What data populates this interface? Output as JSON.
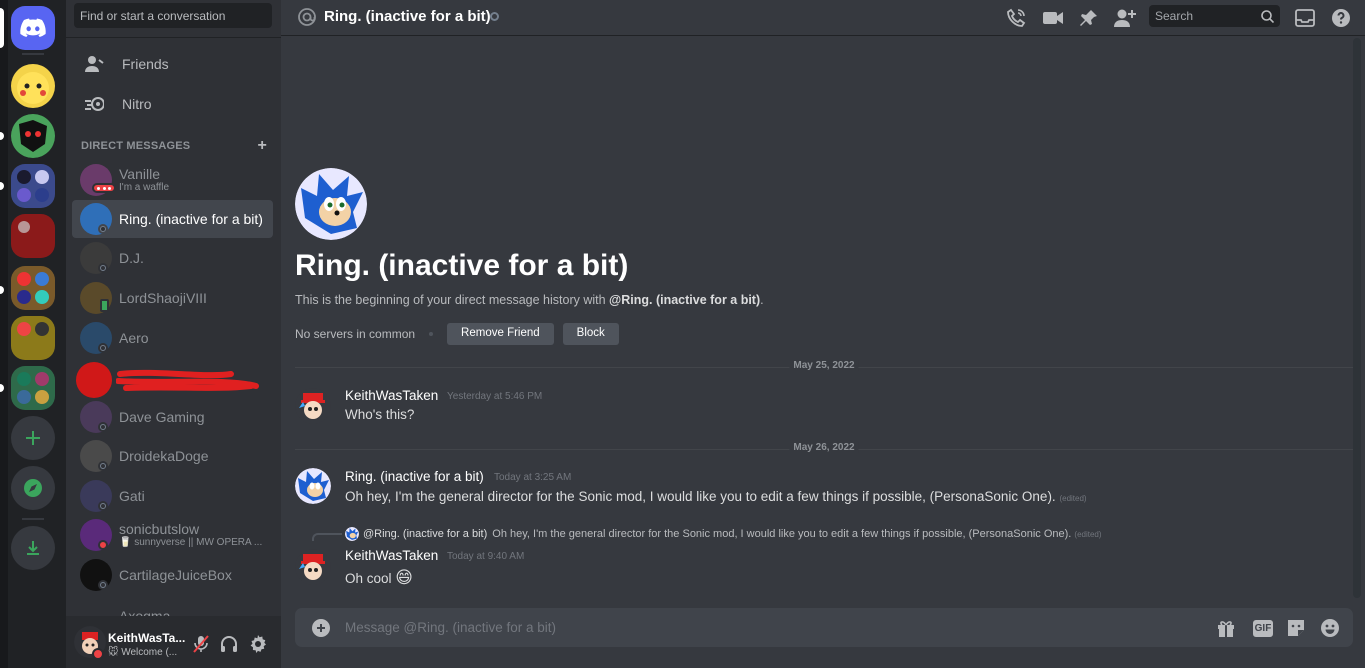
{
  "colors": {
    "blurple": "#5865f2",
    "bg": "#36393f",
    "sidebar": "#2f3136",
    "rail": "#202225",
    "offline": "#747f8d",
    "dnd": "#ed4245",
    "online": "#3ba55d",
    "redacted": "#e02020"
  },
  "rail": {
    "home_icon": "discord-logo-icon",
    "servers": [
      "server-1",
      "server-2",
      "server-3",
      "server-4",
      "server-5",
      "server-6",
      "server-7"
    ],
    "add_icon": "plus-icon",
    "explore_icon": "compass-icon",
    "download_icon": "download-icon"
  },
  "sidebar": {
    "search_placeholder": "Find or start a conversation",
    "nav": [
      {
        "label": "Friends",
        "icon": "friends-icon"
      },
      {
        "label": "Nitro",
        "icon": "nitro-icon"
      }
    ],
    "dm_header": "DIRECT MESSAGES",
    "dms": [
      {
        "name": "Vanille",
        "sub": "I'm a waffle",
        "status": "dnd"
      },
      {
        "name": "Ring. (inactive for a bit)",
        "status": "offline",
        "active": true
      },
      {
        "name": "D.J.",
        "status": "offline"
      },
      {
        "name": "LordShaojiVIII",
        "status": "mobile"
      },
      {
        "name": "Aero",
        "status": "offline"
      },
      {
        "name": "",
        "status": "redacted"
      },
      {
        "name": "Dave Gaming",
        "status": "offline"
      },
      {
        "name": "DroidekaDoge",
        "status": "offline"
      },
      {
        "name": "Gati",
        "status": "offline"
      },
      {
        "name": "sonicbutslow",
        "sub": "🥛 sunnyverse || MW OPERA ...",
        "status": "dnd"
      },
      {
        "name": "CartilageJuiceBox",
        "status": "offline"
      },
      {
        "name": "Axogma",
        "status": "offline"
      }
    ],
    "user": {
      "name": "KeithWasTa...",
      "status_text": "🐭 Welcome (..."
    }
  },
  "header": {
    "title": "Ring. (inactive for a bit)",
    "search_placeholder": "Search"
  },
  "intro": {
    "title": "Ring. (inactive for a bit)",
    "desc_prefix": "This is the beginning of your direct message history with ",
    "desc_mention": "@Ring. (inactive for a bit)",
    "desc_suffix": ".",
    "no_servers": "No servers in common",
    "remove_friend": "Remove Friend",
    "block": "Block"
  },
  "messages": {
    "date1": "May 25, 2022",
    "m1": {
      "author": "KeithWasTaken",
      "time": "Yesterday at 5:46 PM",
      "text": "Who's this?"
    },
    "date2": "May 26, 2022",
    "m2": {
      "author": "Ring. (inactive for a bit)",
      "time": "Today at 3:25 AM",
      "text": "Oh hey, I'm the general director for the Sonic mod, I would like you to edit a few things if possible, (PersonaSonic One).",
      "edited": "(edited)"
    },
    "reply": {
      "author": "@Ring. (inactive for a bit)",
      "text": "Oh hey, I'm the general director for the Sonic mod, I would like you to edit a few things if possible, (PersonaSonic One).",
      "edited": "(edited)"
    },
    "m3": {
      "author": "KeithWasTaken",
      "time": "Today at 9:40 AM",
      "text": "Oh cool",
      "emoji": "😄"
    }
  },
  "composer": {
    "placeholder": "Message @Ring. (inactive for a bit)",
    "gif_label": "GIF"
  }
}
